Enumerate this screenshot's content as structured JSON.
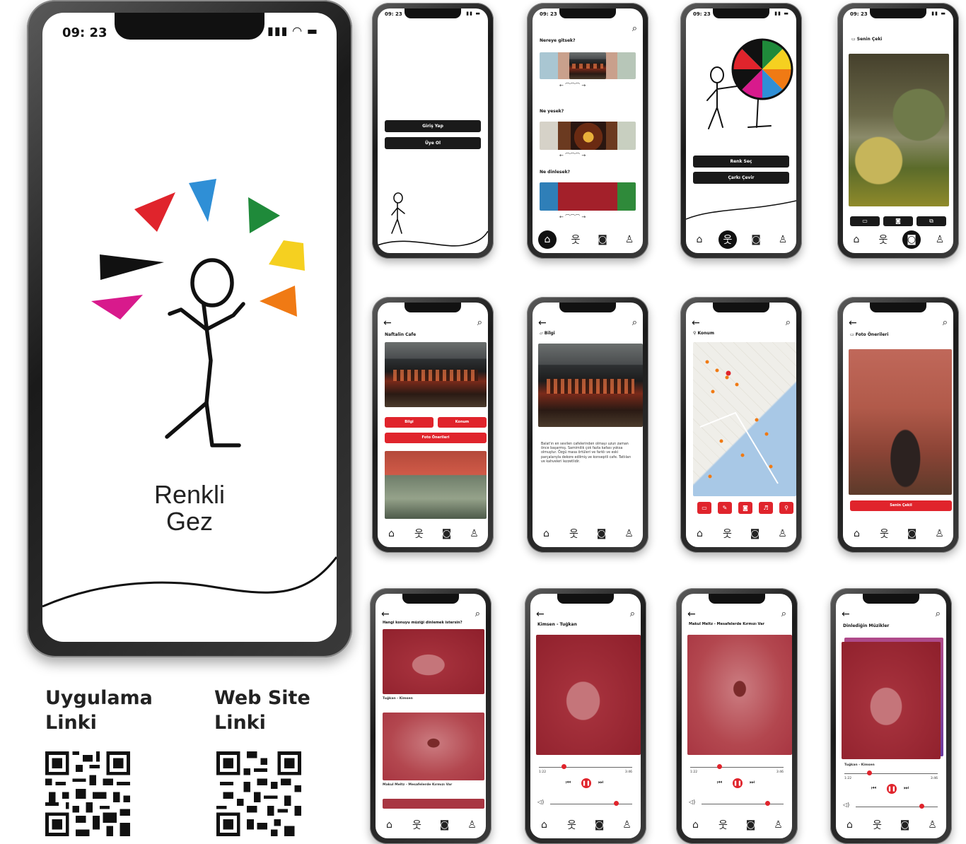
{
  "status": {
    "time": "09: 23",
    "icons": "▮▮▮ ◠ ▬"
  },
  "small_status": {
    "time": "09: 23",
    "icons": "▮▮ ▬"
  },
  "app": {
    "name_line1": "Renkli",
    "name_line2": "Gez"
  },
  "links": {
    "app_line1": "Uygulama",
    "app_line2": "Linki",
    "web_line1": "Web Site",
    "web_line2": "Linki"
  },
  "login": {
    "login_label": "Giriş Yap",
    "signup_label": "Üye Ol"
  },
  "home": {
    "q1": "Nereye gitsek?",
    "q2": "Ne yesek?",
    "q3": "Ne dinlesek?"
  },
  "wheel": {
    "choose_color_label": "Renk Seç",
    "spin_label": "Çarkı Çevir"
  },
  "photo_screen": {
    "title": "Senin Çeki"
  },
  "cafe": {
    "title": "Naftalin Cafe",
    "info_label": "Bilgi",
    "location_label": "Konum",
    "photos_label": "Foto Önerileri"
  },
  "info": {
    "title": "Bilgi",
    "text": "Balat'ın en sevilen cafelerinden olmayı uzun zaman önce başarmış. Samimilik çok fazla kafası yoksa olmuştur. Özgü masa örtüleri ve farklı ve eski parçalarıyla dekore edilmiş ve konseptli cafe. Tatlıları ve kahveleri lezzetlidir."
  },
  "location": {
    "title": "Konum"
  },
  "photo_tips": {
    "title": "Foto Önerileri",
    "take_label": "Senin Çekil"
  },
  "music_list": {
    "title": "Hangi konuyu müziği dinlemek istersin?",
    "item1": "Tuğkan - Kimsen",
    "item2": "Makul Meltz - Mesafelerde Kırmızı Var"
  },
  "player1": {
    "title": "Kimsen - Tuğkan",
    "start": "1:22",
    "end": "3:46"
  },
  "player2": {
    "title": "Makul Meltz - Mesafelerde Kırmızı Var",
    "start": "1:22",
    "end": "3:46"
  },
  "player3": {
    "title": "Dinlediğin Müzikler",
    "song": "Tuğkan - Kimsen",
    "start": "1:22",
    "end": "3:46"
  },
  "colors": {
    "accent_red": "#e0242c",
    "ink": "#111111"
  }
}
